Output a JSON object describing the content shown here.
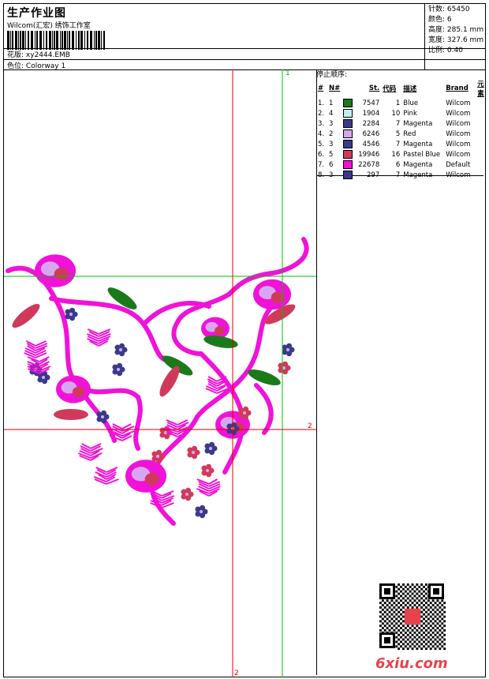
{
  "header": {
    "title": "生产作业图",
    "company": "Wilcom(汇宏) 绣饰工作室",
    "design_label": "花版:",
    "design_value": "xy2444.EMB",
    "colorway_label": "色位:",
    "colorway_value": "Colorway 1"
  },
  "stats": {
    "stitches_label": "针数:",
    "stitches": "65450",
    "colors_label": "颜色:",
    "colors": "6",
    "height_label": "高度:",
    "height": "285.1 mm",
    "width_label": "宽度:",
    "width": "327.6 mm",
    "scale_label": "比例:",
    "scale": "0.40"
  },
  "sequence": {
    "title": "停止顺序:",
    "headers": [
      "#",
      "N#",
      "St.",
      "代码",
      "描述",
      "Brand",
      "元素"
    ],
    "rows": [
      {
        "idx": "1.",
        "n": "1",
        "color": "#1a7a1a",
        "st": "7547",
        "code": "1",
        "desc": "Blue",
        "brand": "Wilcom"
      },
      {
        "idx": "2.",
        "n": "4",
        "color": "#bff0f0",
        "st": "1904",
        "code": "10",
        "desc": "Pink",
        "brand": "Wilcom"
      },
      {
        "idx": "3.",
        "n": "3",
        "color": "#3a3a8c",
        "st": "2284",
        "code": "7",
        "desc": "Magenta",
        "brand": "Wilcom"
      },
      {
        "idx": "4.",
        "n": "2",
        "color": "#d8a6f0",
        "st": "6246",
        "code": "5",
        "desc": "Red",
        "brand": "Wilcom"
      },
      {
        "idx": "5.",
        "n": "3",
        "color": "#3a3a8c",
        "st": "4546",
        "code": "7",
        "desc": "Magenta",
        "brand": "Wilcom"
      },
      {
        "idx": "6.",
        "n": "5",
        "color": "#d03a5a",
        "st": "19946",
        "code": "16",
        "desc": "Pastel Blue",
        "brand": "Wilcom"
      },
      {
        "idx": "7.",
        "n": "6",
        "color": "#f012d8",
        "st": "22678",
        "code": "6",
        "desc": "Magenta",
        "brand": "Default"
      },
      {
        "idx": "8.",
        "n": "3",
        "color": "#3a3a8c",
        "st": "297",
        "code": "7",
        "desc": "Magenta",
        "brand": "Wilcom"
      }
    ]
  },
  "guides": {
    "label_1": "1",
    "label_2_right": "2",
    "label_2_bottom": "2"
  },
  "colors": {
    "magenta": "#f012d8",
    "red": "#d03a5a",
    "navy": "#3a3a8c",
    "green": "#1a7a1a",
    "lilac": "#d8a6f0",
    "guide_red": "#e00000",
    "guide_green": "#00c000"
  },
  "watermark": "6xiu.com"
}
